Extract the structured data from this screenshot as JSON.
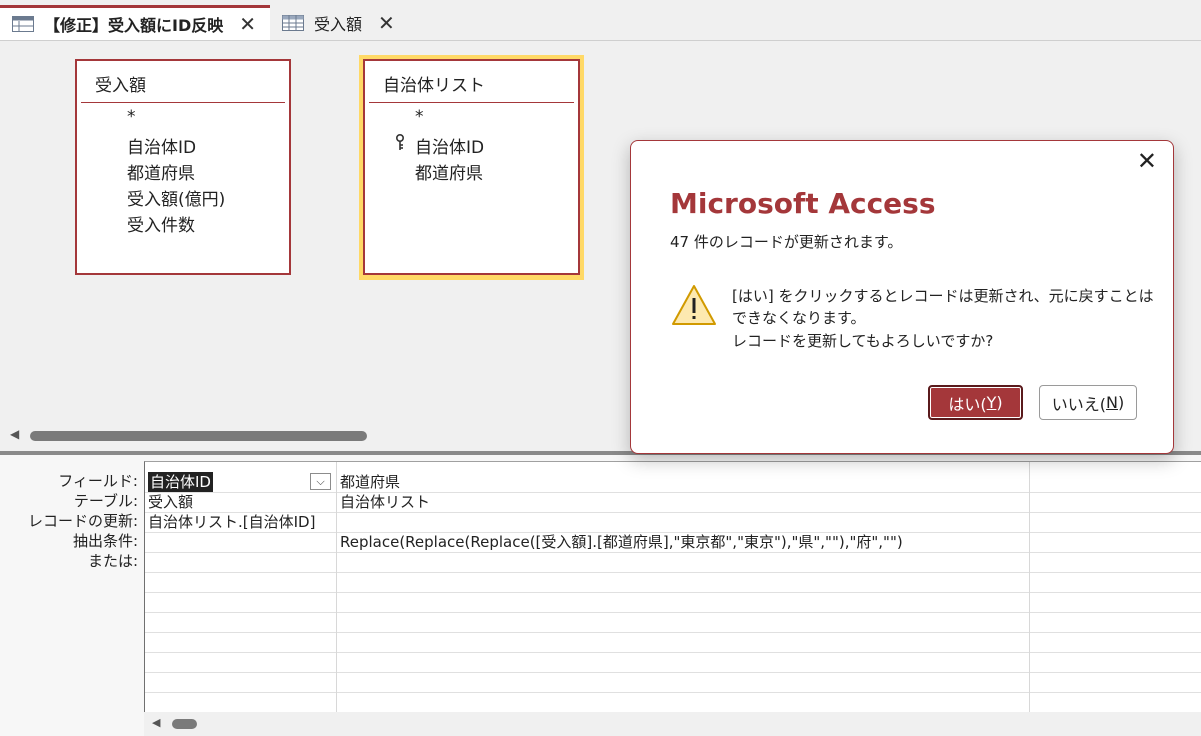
{
  "tabs": [
    {
      "label": "【修正】受入額にID反映",
      "close": "✕",
      "active": true
    },
    {
      "label": "受入額",
      "close": "✕",
      "active": false
    }
  ],
  "design": {
    "tables": [
      {
        "title": "受入額",
        "fields": [
          "*",
          "自治体ID",
          "都道府県",
          "受入額(億円)",
          "受入件数"
        ]
      },
      {
        "title": "自治体リスト",
        "fields": [
          "*",
          "自治体ID",
          "都道府県"
        ],
        "key_field": "自治体ID"
      }
    ]
  },
  "grid": {
    "row_labels": [
      "フィールド:",
      "テーブル:",
      "レコードの更新:",
      "抽出条件:",
      "または:"
    ],
    "columns": [
      {
        "field": "自治体ID",
        "table": "受入額",
        "update": "自治体リスト.[自治体ID]",
        "criteria": ""
      },
      {
        "field": "都道府県",
        "table": "自治体リスト",
        "update": "",
        "criteria": "Replace(Replace(Replace([受入額].[都道府県],\"東京都\",\"東京\"),\"県\",\"\"),\"府\",\"\")"
      }
    ],
    "dropdown_glyph": "⌵"
  },
  "dialog": {
    "title": "Microsoft Access",
    "subtitle": "47 件のレコードが更新されます。",
    "message_lines": [
      "[はい] をクリックするとレコードは更新され、元に戻すことは",
      "できなくなります。",
      "レコードを更新してもよろしいですか?"
    ],
    "yes": {
      "text": "はい(",
      "key": "Y",
      "suffix": ")"
    },
    "no": {
      "text": "いいえ(",
      "key": "N",
      "suffix": ")"
    },
    "close": "✕"
  },
  "colors": {
    "accent": "#a4373a",
    "selected_table_border": "#ffd966"
  }
}
